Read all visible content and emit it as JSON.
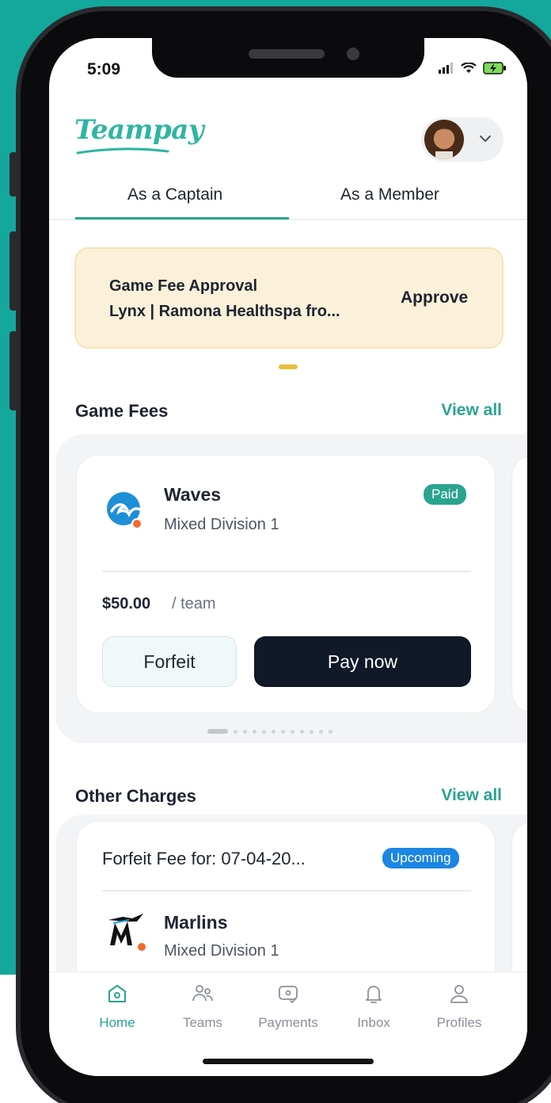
{
  "status_bar": {
    "time": "5:09"
  },
  "header": {
    "logo_text": "Teampay"
  },
  "tabs": [
    {
      "label": "As a Captain",
      "active": true
    },
    {
      "label": "As a Member",
      "active": false
    }
  ],
  "approval_banner": {
    "title": "Game Fee Approval",
    "subtitle": "Lynx | Ramona Healthspa fro...",
    "action_label": "Approve"
  },
  "game_fees": {
    "section_title": "Game Fees",
    "view_all_label": "View all",
    "card": {
      "team_name": "Waves",
      "division": "Mixed Division 1",
      "status_badge": "Paid",
      "price": "$50.00",
      "price_unit": "/ team",
      "forfeit_label": "Forfeit",
      "pay_label": "Pay now"
    },
    "pager": {
      "total": 12,
      "active_index": 0
    }
  },
  "other_charges": {
    "section_title": "Other Charges",
    "view_all_label": "View all",
    "card": {
      "title": "Forfeit Fee for: 07-04-20...",
      "status_badge": "Upcoming",
      "team_name": "Marlins",
      "division": "Mixed Division 1"
    }
  },
  "bottom_nav": [
    {
      "label": "Home",
      "icon": "home-icon",
      "active": true
    },
    {
      "label": "Teams",
      "icon": "teams-icon",
      "active": false
    },
    {
      "label": "Payments",
      "icon": "payments-icon",
      "active": false
    },
    {
      "label": "Inbox",
      "icon": "bell-icon",
      "active": false
    },
    {
      "label": "Profiles",
      "icon": "profile-icon",
      "active": false
    }
  ],
  "colors": {
    "background_teal": "#14a89c",
    "accent": "#2aa391",
    "approval_bg": "#fbf0d9",
    "primary_button": "#111827",
    "upcoming_badge": "#1b86e3",
    "pager_active": "#e9bf3a"
  }
}
